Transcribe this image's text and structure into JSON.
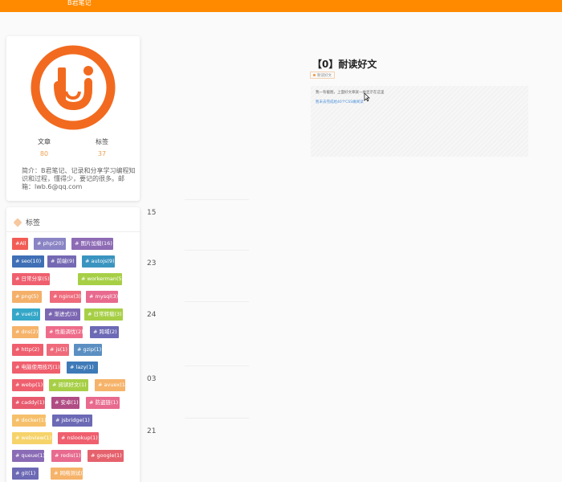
{
  "site": {
    "brand": "B君笔记"
  },
  "profile": {
    "stats": [
      {
        "label": "文章",
        "value": "80"
      },
      {
        "label": "标签",
        "value": "37"
      }
    ],
    "bio": "简介：B君笔记、记录和分享学习编程知识和过程，懂得少，要记的很多。邮箱：lwb.6@qq.com"
  },
  "tags_panel": {
    "title": "标签",
    "tags": [
      {
        "label": "#All",
        "color": "#f25c54"
      },
      {
        "label": "# php(20)",
        "color": "#8a84c4"
      },
      {
        "label": "# 图片加载(16)",
        "color": "#8e6bb5"
      },
      {
        "label": "# seo(10)",
        "color": "#3f6fb5"
      },
      {
        "label": "# 前端(9)",
        "color": "#7569b3"
      },
      {
        "label": "# autojs(9)",
        "color": "#3a94c0"
      },
      {
        "label": "# 日常分享(5)",
        "color": "#ef5f6e"
      },
      {
        "label": "# workerman(5)",
        "color": "#a7cf46"
      },
      {
        "label": "# png(5)",
        "color": "#f4b06a"
      },
      {
        "label": "# nginx(3)",
        "color": "#ef6b7b"
      },
      {
        "label": "# mysql(3)",
        "color": "#e86a8e"
      },
      {
        "label": "# vue(3)",
        "color": "#35a7c8"
      },
      {
        "label": "# 渐进式(3)",
        "color": "#7c67b2"
      },
      {
        "label": "# 日常转载(3)",
        "color": "#a7cf46"
      },
      {
        "label": "# dns(2)",
        "color": "#f6b36a"
      },
      {
        "label": "# 性能调优(2)",
        "color": "#ee6c8a"
      },
      {
        "label": "# 跨域(2)",
        "color": "#6c69b5"
      },
      {
        "label": "# http(2)",
        "color": "#ef5f6e"
      },
      {
        "label": "# js(1)",
        "color": "#ef6b7b"
      },
      {
        "label": "# gzip(1)",
        "color": "#5b8fc2"
      },
      {
        "label": "# 电脑使用技巧(1)",
        "color": "#ef5f6e"
      },
      {
        "label": "# lazy(1)",
        "color": "#3f7ab8"
      },
      {
        "label": "# webp(1)",
        "color": "#ef5f6e"
      },
      {
        "label": "# 阅读好文(1)",
        "color": "#a7cf46"
      },
      {
        "label": "# avuex(1)",
        "color": "#f6b36a"
      },
      {
        "label": "# caddy(1)",
        "color": "#e85a6e"
      },
      {
        "label": "# 安卓(1)",
        "color": "#b04c84"
      },
      {
        "label": "# 防盗链(1)",
        "color": "#e86a8e"
      },
      {
        "label": "# docker(1)",
        "color": "#f6c06a"
      },
      {
        "label": "# jsbridge(1)",
        "color": "#6c69b5"
      },
      {
        "label": "# webview(1)",
        "color": "#f6d36a"
      },
      {
        "label": "# nslookup(1)",
        "color": "#ef5f6e"
      },
      {
        "label": "# queue(1)",
        "color": "#8a6bb5"
      },
      {
        "label": "# redis(1)",
        "color": "#e86a8e"
      },
      {
        "label": "# google(1)",
        "color": "#e5626d"
      },
      {
        "label": "# git(1)",
        "color": "#6c69b5"
      },
      {
        "label": "# 网络测试(1)",
        "color": "#f6b36a"
      }
    ]
  },
  "timeline": {
    "days": [
      "15",
      "23",
      "24",
      "03",
      "21"
    ]
  },
  "post": {
    "title": "【0】耐读好文",
    "tag": "耐读好文",
    "preview_line1": "我一有截图，上面好文章就一并显示在这里",
    "preview_line2": "暂未去完成给40个CSS做阅读"
  },
  "colors": {
    "topbar": "#ff8a00",
    "logo": "#f26a1f",
    "stat_value": "#f0a050"
  }
}
